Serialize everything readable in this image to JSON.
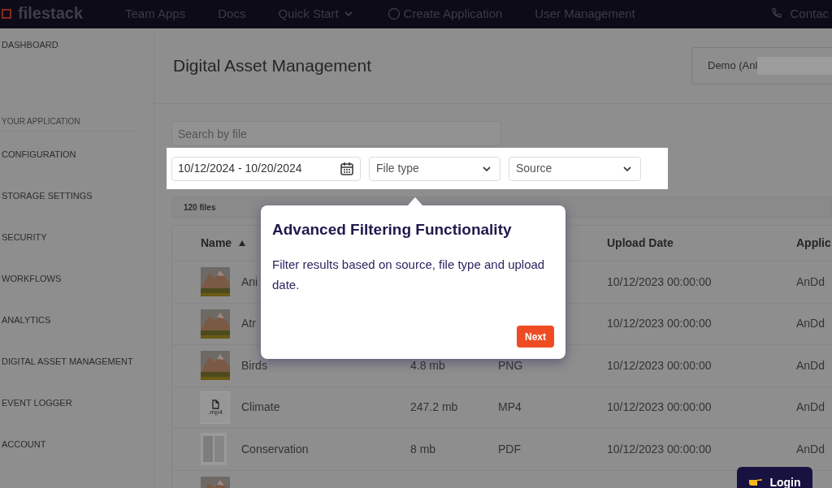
{
  "topbar": {
    "logo": "filestack",
    "nav": [
      {
        "label": "Team Apps",
        "kind": "link"
      },
      {
        "label": "Docs",
        "kind": "link"
      },
      {
        "label": "Quick Start",
        "kind": "dropdown"
      },
      {
        "label": "Create Application",
        "kind": "action"
      },
      {
        "label": "User Management",
        "kind": "link"
      }
    ],
    "contact": "Contac"
  },
  "sidebar": {
    "items": [
      {
        "label": "DASHBOARD",
        "kind": "item"
      },
      {
        "label": "YOUR APPLICATION",
        "kind": "section"
      },
      {
        "label": "CONFIGURATION",
        "kind": "item"
      },
      {
        "label": "STORAGE SETTINGS",
        "kind": "item"
      },
      {
        "label": "SECURITY",
        "kind": "item"
      },
      {
        "label": "WORKFLOWS",
        "kind": "item"
      },
      {
        "label": "ANALYTICS",
        "kind": "item"
      },
      {
        "label": "DIGITAL ASSET MANAGEMENT",
        "kind": "item"
      },
      {
        "label": "EVENT LOGGER",
        "kind": "item"
      },
      {
        "label": "ACCOUNT",
        "kind": "item"
      }
    ]
  },
  "page": {
    "title": "Digital Asset Management",
    "app_select": "Demo (Anl"
  },
  "search": {
    "placeholder": "Search by file"
  },
  "filters": {
    "date_range": "10/12/2024 - 10/20/2024",
    "file_type": {
      "placeholder": "File type"
    },
    "source": {
      "placeholder": "Source"
    }
  },
  "count": "120 files",
  "table": {
    "columns": [
      {
        "label": "Name",
        "sorted": true
      },
      {
        "label": "Upload Date",
        "sorted": false
      },
      {
        "label": "Applic",
        "sorted": false
      }
    ],
    "rows": [
      {
        "name": "Ani",
        "size": "",
        "type": "",
        "date": "10/12/2023 00:00:00",
        "app": "AnDd"
      },
      {
        "name": "Atr",
        "size": "",
        "type": "",
        "date": "10/12/2023 00:00:00",
        "app": "AnDd"
      },
      {
        "name": "Birds",
        "size": "4.8 mb",
        "type": "PNG",
        "date": "10/12/2023 00:00:00",
        "app": "AnDd"
      },
      {
        "kind": "video",
        "thumb_label": ".mp4",
        "name": "Climate",
        "size": "247.2 mb",
        "type": "MP4",
        "date": "10/12/2023 00:00:00",
        "app": "AnDd"
      },
      {
        "kind": "document",
        "name": "Conservation",
        "size": "8 mb",
        "type": "PDF",
        "date": "10/12/2023 00:00:00",
        "app": "AnDd"
      },
      {
        "name": "",
        "size": "",
        "type": "",
        "date": "",
        "app": ""
      }
    ]
  },
  "tour": {
    "title": "Advanced Filtering Functionality",
    "body": "Filter results based on source, file type and upload date.",
    "button": "Next"
  },
  "login": {
    "label": "Login"
  }
}
